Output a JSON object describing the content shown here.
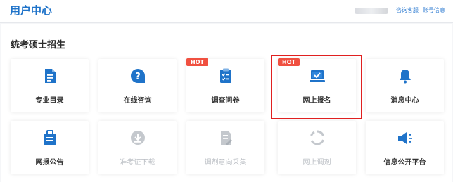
{
  "header": {
    "title": "用户中心",
    "links": [
      "咨询客服",
      "账号信息"
    ]
  },
  "section": {
    "title": "统考硕士招生",
    "hot_badge": "HOT",
    "cards": [
      {
        "label": "专业目录",
        "icon": "document-icon",
        "hot": false,
        "enabled": true
      },
      {
        "label": "在线咨询",
        "icon": "question-chat-icon",
        "hot": false,
        "enabled": true
      },
      {
        "label": "调查问卷",
        "icon": "clipboard-checklist-icon",
        "hot": true,
        "enabled": true
      },
      {
        "label": "网上报名",
        "icon": "laptop-check-icon",
        "hot": true,
        "enabled": true
      },
      {
        "label": "消息中心",
        "icon": "bell-icon",
        "hot": false,
        "enabled": true
      },
      {
        "label": "网报公告",
        "icon": "briefcase-document-icon",
        "hot": false,
        "enabled": true
      },
      {
        "label": "准考证下载",
        "icon": "download-icon",
        "hot": false,
        "enabled": false
      },
      {
        "label": "调剂意向采集",
        "icon": "file-edit-icon",
        "hot": false,
        "enabled": false
      },
      {
        "label": "网上调剂",
        "icon": "refresh-icon",
        "hot": false,
        "enabled": false
      },
      {
        "label": "信息公开平台",
        "icon": "megaphone-icon",
        "hot": false,
        "enabled": true
      }
    ]
  },
  "colors": {
    "accent": "#1f73c9",
    "hot": "#f05040",
    "disabled": "#c4c8cd",
    "highlight": "#e02020"
  }
}
